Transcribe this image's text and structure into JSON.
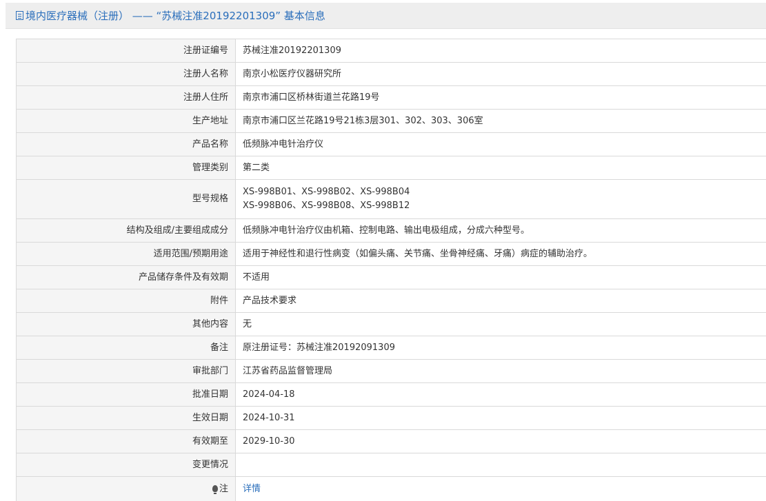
{
  "header": {
    "title": "境内医疗器械（注册） —— “苏械注准20192201309” 基本信息"
  },
  "rows": [
    {
      "label": "注册证编号",
      "value": "苏械注准20192201309"
    },
    {
      "label": "注册人名称",
      "value": "南京小松医疗仪器研究所"
    },
    {
      "label": "注册人住所",
      "value": "南京市浦口区桥林街道兰花路19号"
    },
    {
      "label": "生产地址",
      "value": "南京市浦口区兰花路19号21栋3层301、302、303、306室"
    },
    {
      "label": "产品名称",
      "value": "低频脉冲电针治疗仪"
    },
    {
      "label": "管理类别",
      "value": "第二类"
    },
    {
      "label": "型号规格",
      "value_line1": "XS-998B01、XS-998B02、XS-998B04",
      "value_line2": "XS-998B06、XS-998B08、XS-998B12"
    },
    {
      "label": "结构及组成/主要组成成分",
      "value": "低频脉冲电针治疗仪由机箱、控制电路、输出电极组成，分成六种型号。"
    },
    {
      "label": "适用范围/预期用途",
      "value": "适用于神经性和退行性病变（如偏头痛、关节痛、坐骨神经痛、牙痛）病症的辅助治疗。"
    },
    {
      "label": "产品储存条件及有效期",
      "value": "不适用"
    },
    {
      "label": "附件",
      "value": "产品技术要求"
    },
    {
      "label": "其他内容",
      "value": "无"
    },
    {
      "label": "备注",
      "value": "原注册证号：苏械注准20192091309"
    },
    {
      "label": "审批部门",
      "value": "江苏省药品监督管理局"
    },
    {
      "label": "批准日期",
      "value": "2024-04-18"
    },
    {
      "label": "生效日期",
      "value": "2024-10-31"
    },
    {
      "label": "有效期至",
      "value": "2029-10-30"
    },
    {
      "label": "变更情况",
      "value": ""
    },
    {
      "label": "注",
      "value": "详情"
    }
  ],
  "icons": {
    "title_icon": "document-icon",
    "note_icon": "lightbulb-icon"
  },
  "colors": {
    "link": "#2a6ebb",
    "label_bg": "#f5f5f5",
    "title_bar_bg": "#eeeeee"
  }
}
